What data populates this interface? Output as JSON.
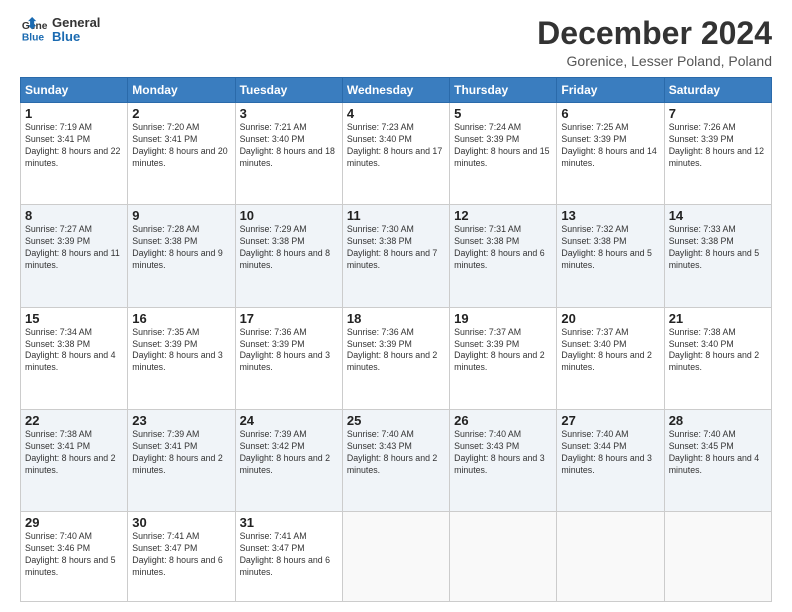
{
  "logo": {
    "line1": "General",
    "line2": "Blue"
  },
  "title": "December 2024",
  "subtitle": "Gorenice, Lesser Poland, Poland",
  "days_header": [
    "Sunday",
    "Monday",
    "Tuesday",
    "Wednesday",
    "Thursday",
    "Friday",
    "Saturday"
  ],
  "weeks": [
    [
      {
        "num": "1",
        "rise": "7:19 AM",
        "set": "3:41 PM",
        "daylight": "8 hours and 22 minutes."
      },
      {
        "num": "2",
        "rise": "7:20 AM",
        "set": "3:41 PM",
        "daylight": "8 hours and 20 minutes."
      },
      {
        "num": "3",
        "rise": "7:21 AM",
        "set": "3:40 PM",
        "daylight": "8 hours and 18 minutes."
      },
      {
        "num": "4",
        "rise": "7:23 AM",
        "set": "3:40 PM",
        "daylight": "8 hours and 17 minutes."
      },
      {
        "num": "5",
        "rise": "7:24 AM",
        "set": "3:39 PM",
        "daylight": "8 hours and 15 minutes."
      },
      {
        "num": "6",
        "rise": "7:25 AM",
        "set": "3:39 PM",
        "daylight": "8 hours and 14 minutes."
      },
      {
        "num": "7",
        "rise": "7:26 AM",
        "set": "3:39 PM",
        "daylight": "8 hours and 12 minutes."
      }
    ],
    [
      {
        "num": "8",
        "rise": "7:27 AM",
        "set": "3:39 PM",
        "daylight": "8 hours and 11 minutes."
      },
      {
        "num": "9",
        "rise": "7:28 AM",
        "set": "3:38 PM",
        "daylight": "8 hours and 9 minutes."
      },
      {
        "num": "10",
        "rise": "7:29 AM",
        "set": "3:38 PM",
        "daylight": "8 hours and 8 minutes."
      },
      {
        "num": "11",
        "rise": "7:30 AM",
        "set": "3:38 PM",
        "daylight": "8 hours and 7 minutes."
      },
      {
        "num": "12",
        "rise": "7:31 AM",
        "set": "3:38 PM",
        "daylight": "8 hours and 6 minutes."
      },
      {
        "num": "13",
        "rise": "7:32 AM",
        "set": "3:38 PM",
        "daylight": "8 hours and 5 minutes."
      },
      {
        "num": "14",
        "rise": "7:33 AM",
        "set": "3:38 PM",
        "daylight": "8 hours and 5 minutes."
      }
    ],
    [
      {
        "num": "15",
        "rise": "7:34 AM",
        "set": "3:38 PM",
        "daylight": "8 hours and 4 minutes."
      },
      {
        "num": "16",
        "rise": "7:35 AM",
        "set": "3:39 PM",
        "daylight": "8 hours and 3 minutes."
      },
      {
        "num": "17",
        "rise": "7:36 AM",
        "set": "3:39 PM",
        "daylight": "8 hours and 3 minutes."
      },
      {
        "num": "18",
        "rise": "7:36 AM",
        "set": "3:39 PM",
        "daylight": "8 hours and 2 minutes."
      },
      {
        "num": "19",
        "rise": "7:37 AM",
        "set": "3:39 PM",
        "daylight": "8 hours and 2 minutes."
      },
      {
        "num": "20",
        "rise": "7:37 AM",
        "set": "3:40 PM",
        "daylight": "8 hours and 2 minutes."
      },
      {
        "num": "21",
        "rise": "7:38 AM",
        "set": "3:40 PM",
        "daylight": "8 hours and 2 minutes."
      }
    ],
    [
      {
        "num": "22",
        "rise": "7:38 AM",
        "set": "3:41 PM",
        "daylight": "8 hours and 2 minutes."
      },
      {
        "num": "23",
        "rise": "7:39 AM",
        "set": "3:41 PM",
        "daylight": "8 hours and 2 minutes."
      },
      {
        "num": "24",
        "rise": "7:39 AM",
        "set": "3:42 PM",
        "daylight": "8 hours and 2 minutes."
      },
      {
        "num": "25",
        "rise": "7:40 AM",
        "set": "3:43 PM",
        "daylight": "8 hours and 2 minutes."
      },
      {
        "num": "26",
        "rise": "7:40 AM",
        "set": "3:43 PM",
        "daylight": "8 hours and 3 minutes."
      },
      {
        "num": "27",
        "rise": "7:40 AM",
        "set": "3:44 PM",
        "daylight": "8 hours and 3 minutes."
      },
      {
        "num": "28",
        "rise": "7:40 AM",
        "set": "3:45 PM",
        "daylight": "8 hours and 4 minutes."
      }
    ],
    [
      {
        "num": "29",
        "rise": "7:40 AM",
        "set": "3:46 PM",
        "daylight": "8 hours and 5 minutes."
      },
      {
        "num": "30",
        "rise": "7:41 AM",
        "set": "3:47 PM",
        "daylight": "8 hours and 6 minutes."
      },
      {
        "num": "31",
        "rise": "7:41 AM",
        "set": "3:47 PM",
        "daylight": "8 hours and 6 minutes."
      },
      null,
      null,
      null,
      null
    ]
  ]
}
